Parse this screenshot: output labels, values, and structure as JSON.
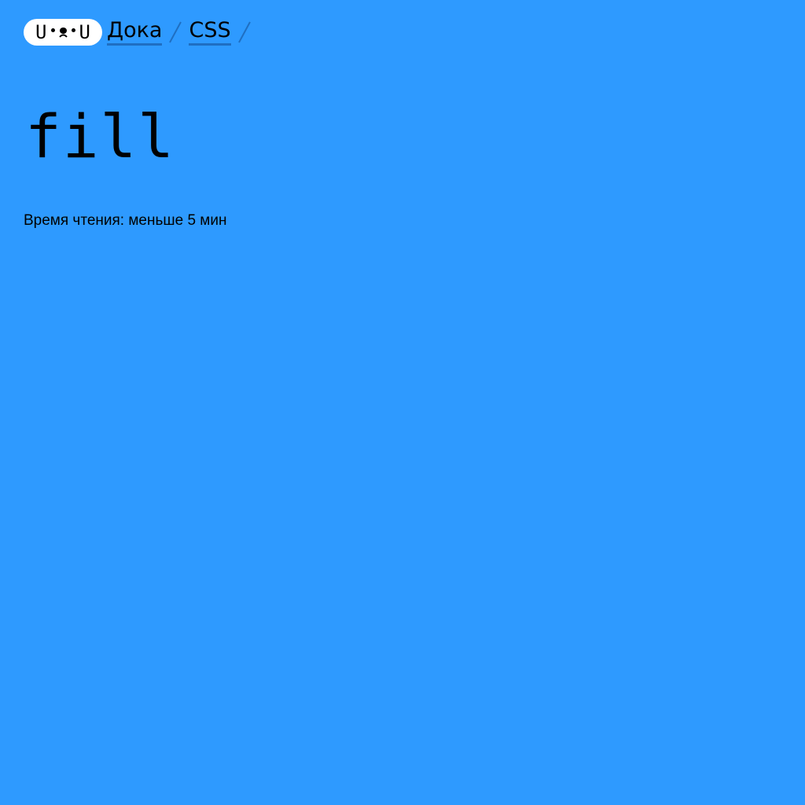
{
  "colors": {
    "background": "#2e9aff",
    "logo_bg": "#ffffff",
    "link_underline": "#1f6fc2",
    "text": "#000000"
  },
  "header": {
    "logo_icon": "doka-face-logo-icon",
    "breadcrumbs": [
      {
        "label": "Дока"
      },
      {
        "label": "CSS"
      }
    ]
  },
  "article": {
    "title": "fill",
    "reading_time": "Время чтения: меньше 5 мин"
  }
}
